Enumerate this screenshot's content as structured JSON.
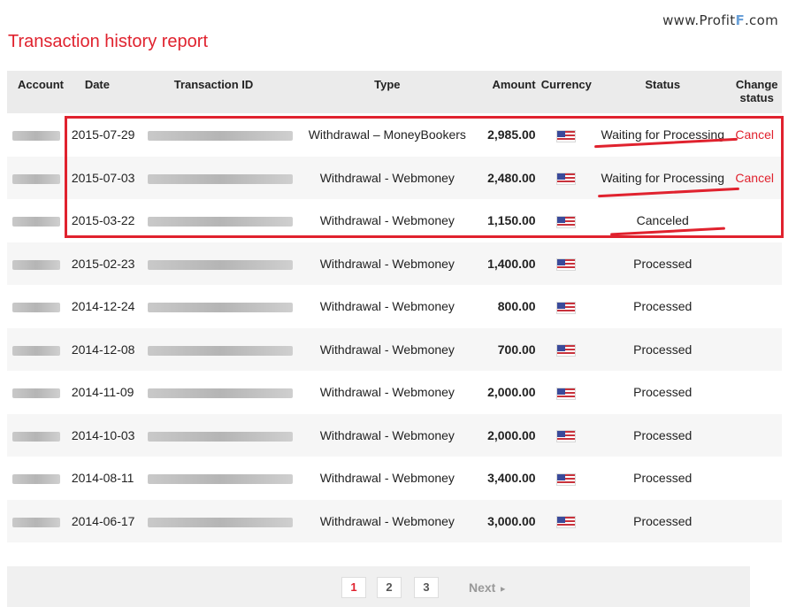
{
  "watermark": {
    "prefix": "www.Profit",
    "mark": "F",
    "suffix": ".com"
  },
  "page_title": "Transaction history report",
  "table": {
    "headers": {
      "account": "Account",
      "date": "Date",
      "transaction_id": "Transaction ID",
      "type": "Type",
      "amount": "Amount",
      "currency": "Currency",
      "status": "Status",
      "change_status_line1": "Change",
      "change_status_line2": "status"
    },
    "rows": [
      {
        "date": "2015-07-29",
        "type": "Withdrawal – MoneyBookers",
        "amount": "2,985.00",
        "currency_icon": "us-flag-icon",
        "status": "Waiting for Processing",
        "change": "Cancel"
      },
      {
        "date": "2015-07-03",
        "type": "Withdrawal - Webmoney",
        "amount": "2,480.00",
        "currency_icon": "us-flag-icon",
        "status": "Waiting for Processing",
        "change": "Cancel"
      },
      {
        "date": "2015-03-22",
        "type": "Withdrawal - Webmoney",
        "amount": "1,150.00",
        "currency_icon": "us-flag-icon",
        "status": "Canceled",
        "change": ""
      },
      {
        "date": "2015-02-23",
        "type": "Withdrawal - Webmoney",
        "amount": "1,400.00",
        "currency_icon": "us-flag-icon",
        "status": "Processed",
        "change": ""
      },
      {
        "date": "2014-12-24",
        "type": "Withdrawal - Webmoney",
        "amount": "800.00",
        "currency_icon": "us-flag-icon",
        "status": "Processed",
        "change": ""
      },
      {
        "date": "2014-12-08",
        "type": "Withdrawal - Webmoney",
        "amount": "700.00",
        "currency_icon": "us-flag-icon",
        "status": "Processed",
        "change": ""
      },
      {
        "date": "2014-11-09",
        "type": "Withdrawal - Webmoney",
        "amount": "2,000.00",
        "currency_icon": "us-flag-icon",
        "status": "Processed",
        "change": ""
      },
      {
        "date": "2014-10-03",
        "type": "Withdrawal - Webmoney",
        "amount": "2,000.00",
        "currency_icon": "us-flag-icon",
        "status": "Processed",
        "change": ""
      },
      {
        "date": "2014-08-11",
        "type": "Withdrawal - Webmoney",
        "amount": "3,400.00",
        "currency_icon": "us-flag-icon",
        "status": "Processed",
        "change": ""
      },
      {
        "date": "2014-06-17",
        "type": "Withdrawal - Webmoney",
        "amount": "3,000.00",
        "currency_icon": "us-flag-icon",
        "status": "Processed",
        "change": ""
      }
    ]
  },
  "pagination": {
    "pages": [
      "1",
      "2",
      "3"
    ],
    "active_page": "1",
    "next_label": "Next",
    "next_icon": "triangle-right-icon"
  },
  "colors": {
    "accent_red": "#e0222e",
    "header_bg": "#ebebeb",
    "stripe_bg": "#f6f6f6"
  }
}
